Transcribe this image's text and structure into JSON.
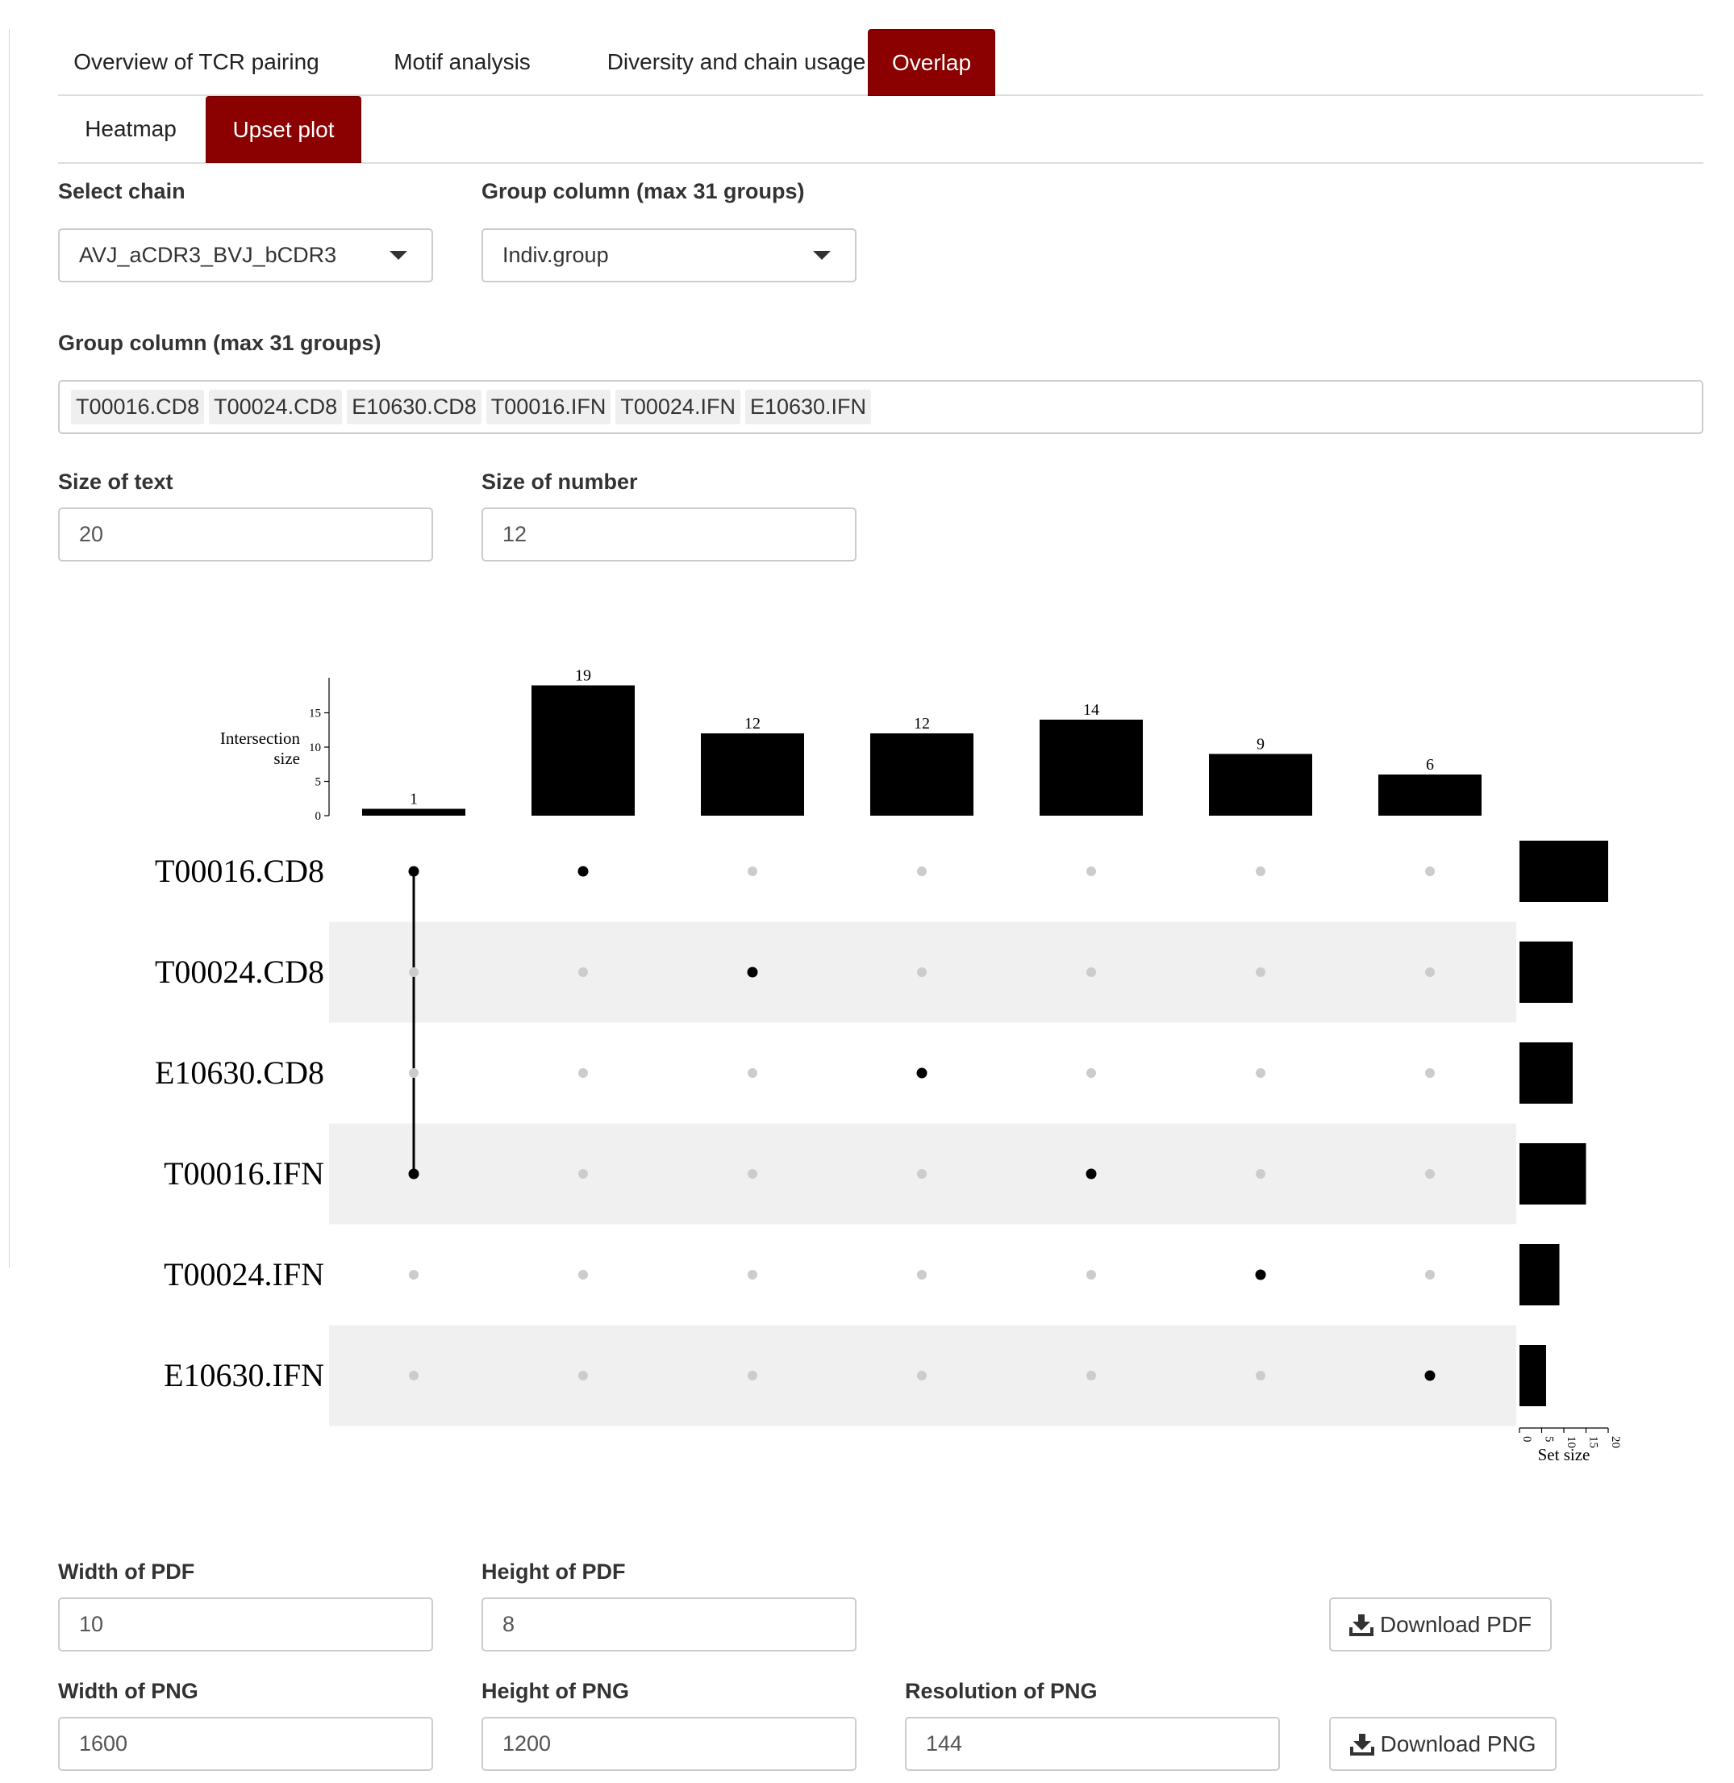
{
  "tabs": {
    "main": [
      {
        "label": "Overview of TCR pairing",
        "active": false
      },
      {
        "label": "Motif analysis",
        "active": false
      },
      {
        "label": "Diversity and chain usage",
        "active": false
      },
      {
        "label": "Overlap",
        "active": true
      }
    ],
    "sub": [
      {
        "label": "Heatmap",
        "active": false
      },
      {
        "label": "Upset plot",
        "active": true
      }
    ]
  },
  "controls": {
    "select_chain": {
      "label": "Select chain",
      "value": "AVJ_aCDR3_BVJ_bCDR3"
    },
    "group_column_select": {
      "label": "Group column (max 31 groups)",
      "value": "Indiv.group"
    },
    "group_column_multi": {
      "label": "Group column (max 31 groups)",
      "chips": [
        "T00016.CD8",
        "T00024.CD8",
        "E10630.CD8",
        "T00016.IFN",
        "T00024.IFN",
        "E10630.IFN"
      ]
    },
    "size_of_text": {
      "label": "Size of text",
      "value": "20"
    },
    "size_of_number": {
      "label": "Size of number",
      "value": "12"
    }
  },
  "downloads": {
    "width_pdf": {
      "label": "Width of PDF",
      "value": "10"
    },
    "height_pdf": {
      "label": "Height of PDF",
      "value": "8"
    },
    "download_pdf_label": "Download PDF",
    "width_png": {
      "label": "Width of PNG",
      "value": "1600"
    },
    "height_png": {
      "label": "Height of PNG",
      "value": "1200"
    },
    "resolution_png": {
      "label": "Resolution of PNG",
      "value": "144"
    },
    "download_png_label": "Download PNG",
    "download_icon": "download-icon"
  },
  "colors": {
    "accent": "#8b0000",
    "bar": "#000000",
    "dot_active": "#000000",
    "dot_inactive": "#cccccc",
    "stripe": "#f0f0f0"
  },
  "chart_data": {
    "type": "upset",
    "sets": [
      "T00016.CD8",
      "T00024.CD8",
      "E10630.CD8",
      "T00016.IFN",
      "T00024.IFN",
      "E10630.IFN"
    ],
    "set_sizes": [
      20,
      12,
      12,
      15,
      9,
      6
    ],
    "intersections": [
      {
        "members": [
          "T00016.CD8",
          "T00016.IFN"
        ],
        "size": 1
      },
      {
        "members": [
          "T00016.CD8"
        ],
        "size": 19
      },
      {
        "members": [
          "T00024.CD8"
        ],
        "size": 12
      },
      {
        "members": [
          "E10630.CD8"
        ],
        "size": 12
      },
      {
        "members": [
          "T00016.IFN"
        ],
        "size": 14
      },
      {
        "members": [
          "T00024.IFN"
        ],
        "size": 9
      },
      {
        "members": [
          "E10630.IFN"
        ],
        "size": 6
      }
    ],
    "intersection_axis": {
      "label_lines": [
        "Intersection",
        "size"
      ],
      "ticks": [
        0,
        5,
        10,
        15
      ],
      "ylim": [
        0,
        20
      ]
    },
    "set_size_axis": {
      "label": "Set size",
      "ticks": [
        0,
        5,
        10,
        15,
        20
      ],
      "xlim": [
        0,
        20
      ]
    }
  }
}
